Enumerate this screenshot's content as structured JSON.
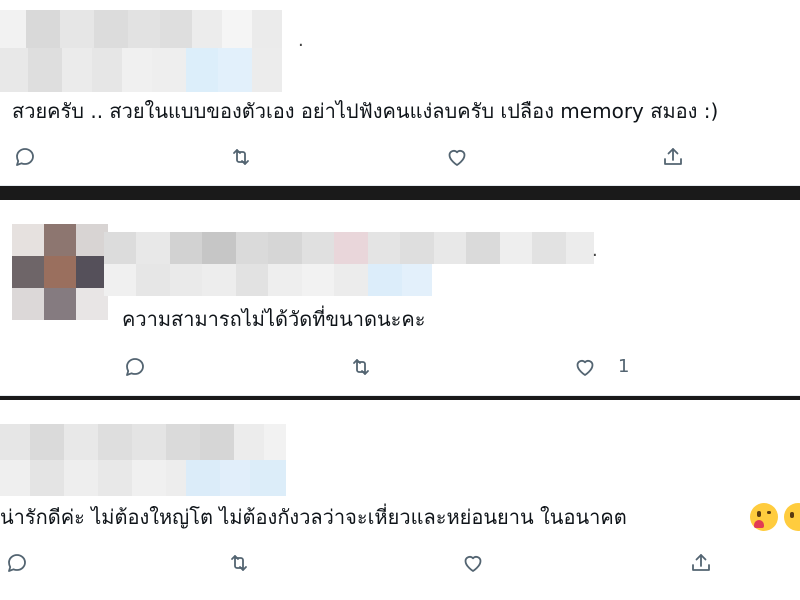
{
  "tweets": [
    {
      "reply": "สวยครับ .. สวยในแบบของตัวเอง อย่าไปฟังคนแง่ลบครับ เปลือง memory สมอง :)",
      "like_count": ""
    },
    {
      "reply": "ความสามารถไม่ได้วัดที่ขนาดนะคะ",
      "like_count": "1"
    },
    {
      "reply": "น่ารักดีค่ะ ไม่ต้องใหญ่โต ไม่ต้องกังวลว่าจะเหี่ยวและหย่อนยาน ในอนาคต",
      "like_count": ""
    }
  ],
  "icons": [
    "reply-icon",
    "retweet-icon",
    "like-icon",
    "share-icon",
    "kiss-emoji-icon",
    "smile-emoji-icon"
  ],
  "colors": {
    "icon": "#536471",
    "background": "#ffffff",
    "separator": "#1a1a1a"
  }
}
